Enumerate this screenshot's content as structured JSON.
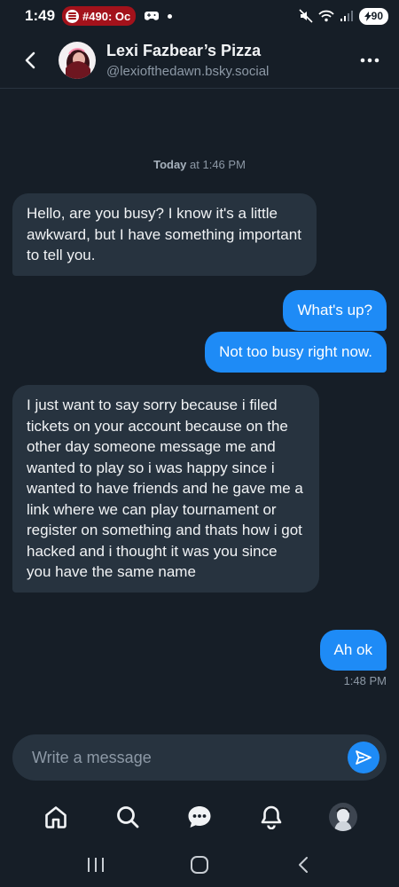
{
  "status_bar": {
    "time": "1:49",
    "notification_pill": "#490: Oc",
    "battery": "90"
  },
  "header": {
    "name": "Lexi Fazbear’s Pizza",
    "handle": "@lexiofthedawn.bsky.social"
  },
  "conversation": {
    "date_bold": "Today",
    "date_rest": " at 1:46 PM",
    "messages": [
      {
        "from": "them",
        "text": "Hello, are you busy? I know it's a little awkward, but I have something important to tell you."
      },
      {
        "from": "me",
        "text": "What's up?"
      },
      {
        "from": "me",
        "text": "Not too busy right now."
      },
      {
        "from": "them",
        "text": "I just want to say sorry because i filed tickets on your account because on the other day someone message me and wanted to play so i was happy since i wanted to have friends and he gave me a link where we can play tournament or register on something and thats how i got hacked and i thought it was you since you have the same name"
      },
      {
        "from": "me",
        "text": "Ah ok"
      }
    ],
    "last_time": "1:48 PM"
  },
  "composer": {
    "placeholder": "Write a message"
  },
  "colors": {
    "background": "#161e27",
    "received_bubble": "#27333f",
    "sent_bubble": "#1e8bf6"
  },
  "icons": {
    "nav": [
      "home-icon",
      "search-icon",
      "chat-icon",
      "bell-icon",
      "profile-avatar"
    ],
    "system": [
      "recents-icon",
      "home-circle-icon",
      "back-chevron-icon"
    ]
  }
}
